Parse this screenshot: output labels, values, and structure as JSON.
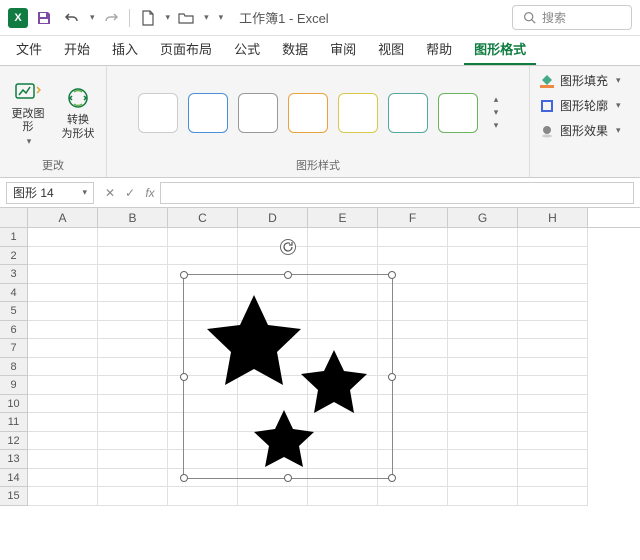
{
  "titlebar": {
    "title": "工作簿1 - Excel",
    "search_placeholder": "搜索"
  },
  "tabs": [
    "文件",
    "开始",
    "插入",
    "页面布局",
    "公式",
    "数据",
    "审阅",
    "视图",
    "帮助",
    "图形格式"
  ],
  "active_tab_index": 9,
  "ribbon": {
    "group_change": {
      "label": "更改",
      "change_graphic": "更改图\n形",
      "convert_shape": "转换\n为形状"
    },
    "group_styles": {
      "label": "图形样式"
    },
    "fill": "图形填充",
    "outline": "图形轮廓",
    "effects": "图形效果"
  },
  "formula_bar": {
    "name": "图形 14",
    "fx": "fx"
  },
  "columns": [
    "A",
    "B",
    "C",
    "D",
    "E",
    "F",
    "G",
    "H"
  ],
  "rows": [
    1,
    2,
    3,
    4,
    5,
    6,
    7,
    8,
    9,
    10,
    11,
    12,
    13,
    14,
    15
  ]
}
